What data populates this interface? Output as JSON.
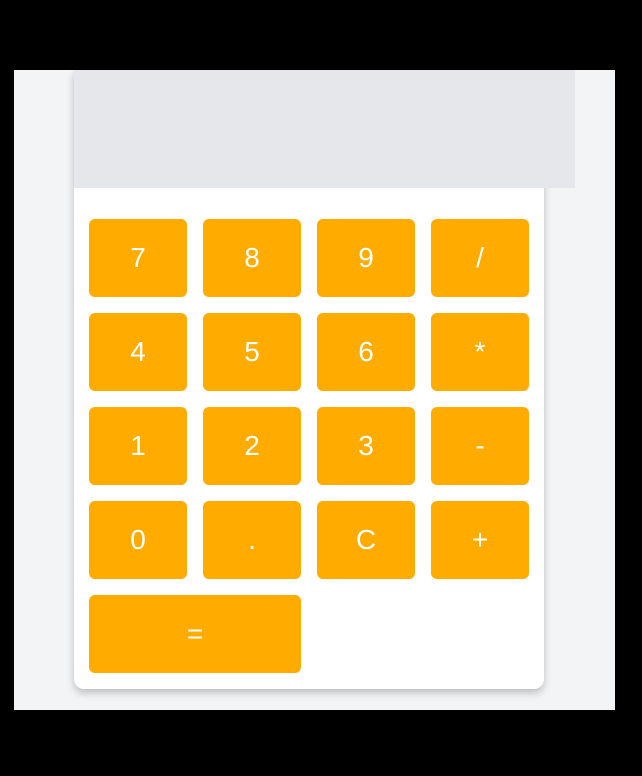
{
  "display": {
    "value": ""
  },
  "keys": {
    "k7": "7",
    "k8": "8",
    "k9": "9",
    "divide": "/",
    "k4": "4",
    "k5": "5",
    "k6": "6",
    "multiply": "*",
    "k1": "1",
    "k2": "2",
    "k3": "3",
    "subtract": "-",
    "k0": "0",
    "decimal": ".",
    "clear": "C",
    "add": "+",
    "equals": "="
  },
  "colors": {
    "key_background": "#ffab00",
    "key_text": "#ffffff",
    "display_background": "#e5e7eb",
    "panel_background": "#ffffff",
    "page_background": "#f3f4f6"
  }
}
